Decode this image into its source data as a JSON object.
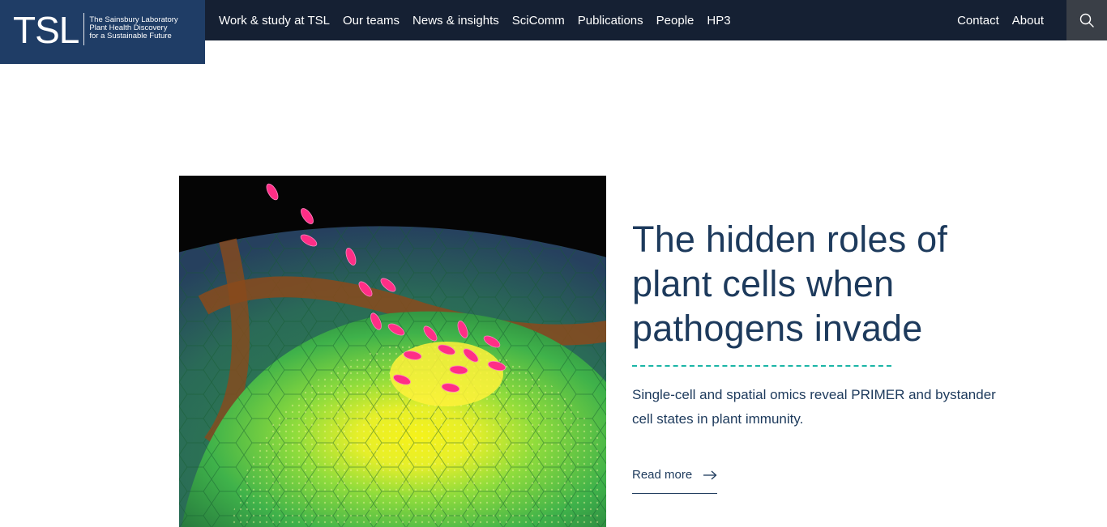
{
  "logo": {
    "mark": "TSL",
    "line1": "The Sainsbury Laboratory",
    "line2": "Plant Health Discovery",
    "line3": "for a Sustainable Future"
  },
  "nav": {
    "items": [
      {
        "label": "Work & study at TSL"
      },
      {
        "label": "Our teams"
      },
      {
        "label": "News & insights"
      },
      {
        "label": "SciComm"
      },
      {
        "label": "Publications"
      },
      {
        "label": "People"
      },
      {
        "label": "HP3"
      }
    ],
    "right": [
      {
        "label": "Contact"
      },
      {
        "label": "About"
      }
    ],
    "search_icon": "search-icon"
  },
  "feature": {
    "headline": "The hidden roles of plant cells when pathogens invade",
    "summary": "Single-cell and spatial omics reveal PRIMER and bystander cell states in plant immunity.",
    "read_more": "Read more",
    "read_more_icon": "arrow-right-icon"
  },
  "colors": {
    "topbar": "#152033",
    "logo_bg": "#1f3d66",
    "heading": "#1d3a5c",
    "accent_dash": "#1bb5a6",
    "search_bg": "#3a3f47"
  }
}
